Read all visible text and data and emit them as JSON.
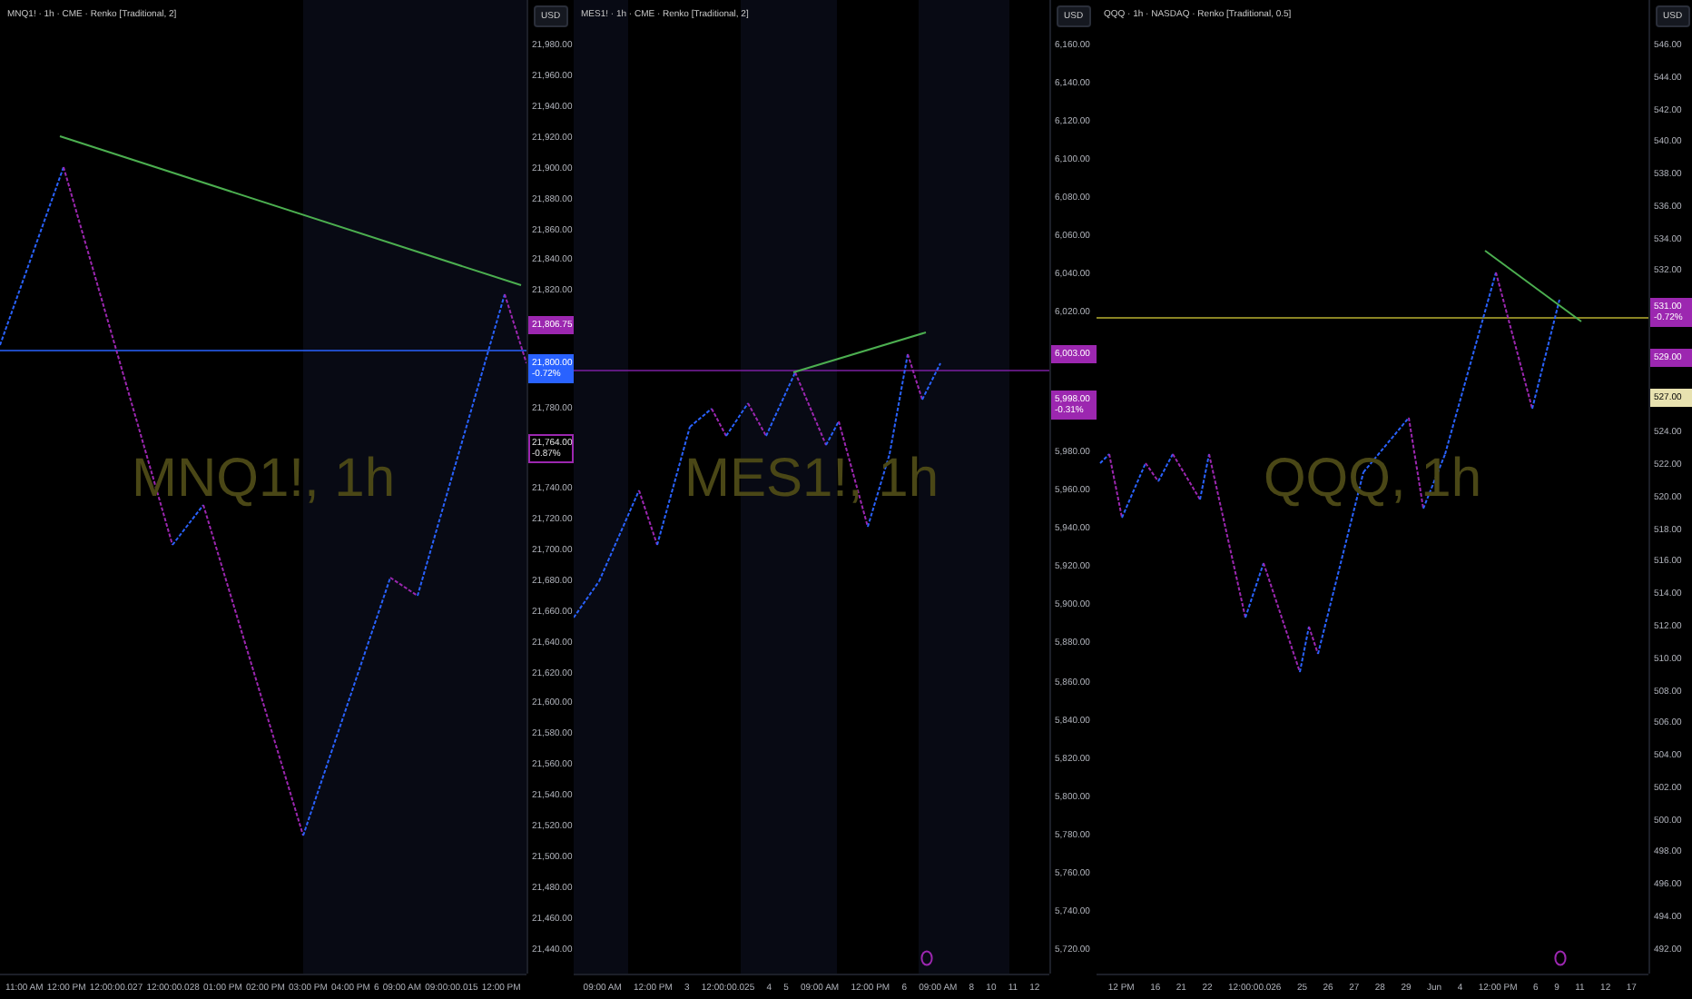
{
  "panels": [
    {
      "header": "MNQ1! · 1h · CME · Renko [Traditional, 2]",
      "watermark": "MNQ1!, 1h",
      "currency": "USD",
      "axis": [
        {
          "kind": "label",
          "lines": [
            "21,980.00"
          ]
        },
        {
          "kind": "label",
          "lines": [
            "21,960.00"
          ]
        },
        {
          "kind": "label",
          "lines": [
            "21,940.00"
          ]
        },
        {
          "kind": "label",
          "lines": [
            "21,920.00"
          ]
        },
        {
          "kind": "label",
          "lines": [
            "21,900.00"
          ]
        },
        {
          "kind": "label",
          "lines": [
            "21,880.00"
          ]
        },
        {
          "kind": "label",
          "lines": [
            "21,860.00"
          ]
        },
        {
          "kind": "label",
          "lines": [
            "21,840.00"
          ]
        },
        {
          "kind": "label",
          "lines": [
            "21,820.00"
          ]
        },
        {
          "kind": "tag",
          "lines": [
            "21,806.75"
          ],
          "color": "#9c27b0"
        },
        {
          "kind": "tag",
          "lines": [
            "21,800.00",
            "-0.72%"
          ],
          "color": "#2962ff"
        },
        {
          "kind": "label",
          "lines": [
            "21,780.00"
          ]
        },
        {
          "kind": "outline_tag",
          "lines": [
            "21,764.00",
            "-0.87%"
          ],
          "color": "#9c27b0"
        },
        {
          "kind": "label",
          "lines": [
            "21,740.00"
          ]
        },
        {
          "kind": "label",
          "lines": [
            "21,720.00"
          ]
        },
        {
          "kind": "label",
          "lines": [
            "21,700.00"
          ]
        },
        {
          "kind": "label",
          "lines": [
            "21,680.00"
          ]
        },
        {
          "kind": "label",
          "lines": [
            "21,660.00"
          ]
        },
        {
          "kind": "label",
          "lines": [
            "21,640.00"
          ]
        },
        {
          "kind": "label",
          "lines": [
            "21,620.00"
          ]
        },
        {
          "kind": "label",
          "lines": [
            "21,600.00"
          ]
        },
        {
          "kind": "label",
          "lines": [
            "21,580.00"
          ]
        },
        {
          "kind": "label",
          "lines": [
            "21,560.00"
          ]
        },
        {
          "kind": "label",
          "lines": [
            "21,540.00"
          ]
        },
        {
          "kind": "label",
          "lines": [
            "21,520.00"
          ]
        },
        {
          "kind": "label",
          "lines": [
            "21,500.00"
          ]
        },
        {
          "kind": "label",
          "lines": [
            "21,480.00"
          ]
        },
        {
          "kind": "label",
          "lines": [
            "21,460.00"
          ]
        },
        {
          "kind": "label",
          "lines": [
            "21,440.00"
          ]
        }
      ],
      "time_labels": [
        "11:00 AM",
        "12:00 PM",
        "12:00:00.027",
        "12:00:00.028",
        "01:00 PM",
        "02:00 PM",
        "03:00 PM",
        "04:00 PM",
        "6",
        "09:00 AM",
        "09:00:00.015",
        "12:00 PM"
      ]
    },
    {
      "header": "MES1! · 1h · CME · Renko [Traditional, 2]",
      "watermark": "MES1!, 1h",
      "currency": "USD",
      "axis": [
        {
          "kind": "label",
          "lines": [
            "6,160.00"
          ]
        },
        {
          "kind": "label",
          "lines": [
            "6,140.00"
          ]
        },
        {
          "kind": "label",
          "lines": [
            "6,120.00"
          ]
        },
        {
          "kind": "label",
          "lines": [
            "6,100.00"
          ]
        },
        {
          "kind": "label",
          "lines": [
            "6,080.00"
          ]
        },
        {
          "kind": "label",
          "lines": [
            "6,060.00"
          ]
        },
        {
          "kind": "label",
          "lines": [
            "6,040.00"
          ]
        },
        {
          "kind": "label",
          "lines": [
            "6,020.00"
          ]
        },
        {
          "kind": "tag",
          "lines": [
            "6,003.00"
          ],
          "color": "#9c27b0"
        },
        {
          "kind": "tag",
          "lines": [
            "5,998.00",
            "-0.31%"
          ],
          "color": "#9c27b0"
        },
        {
          "kind": "label",
          "lines": [
            "5,980.00"
          ]
        },
        {
          "kind": "label",
          "lines": [
            "5,960.00"
          ]
        },
        {
          "kind": "label",
          "lines": [
            "5,940.00"
          ]
        },
        {
          "kind": "label",
          "lines": [
            "5,920.00"
          ]
        },
        {
          "kind": "label",
          "lines": [
            "5,900.00"
          ]
        },
        {
          "kind": "label",
          "lines": [
            "5,880.00"
          ]
        },
        {
          "kind": "label",
          "lines": [
            "5,860.00"
          ]
        },
        {
          "kind": "label",
          "lines": [
            "5,840.00"
          ]
        },
        {
          "kind": "label",
          "lines": [
            "5,820.00"
          ]
        },
        {
          "kind": "label",
          "lines": [
            "5,800.00"
          ]
        },
        {
          "kind": "label",
          "lines": [
            "5,780.00"
          ]
        },
        {
          "kind": "label",
          "lines": [
            "5,760.00"
          ]
        },
        {
          "kind": "label",
          "lines": [
            "5,740.00"
          ]
        },
        {
          "kind": "label",
          "lines": [
            "5,720.00"
          ]
        }
      ],
      "time_labels": [
        "09:00 AM",
        "12:00 PM",
        "3",
        "12:00:00.025",
        "4",
        "5",
        "09:00 AM",
        "12:00 PM",
        "6",
        "09:00 AM",
        "8",
        "10",
        "11",
        "12"
      ],
      "has_event": true
    },
    {
      "header": "QQQ · 1h · NASDAQ · Renko [Traditional, 0.5]",
      "watermark": "QQQ, 1h",
      "currency": "USD",
      "axis": [
        {
          "kind": "label",
          "lines": [
            "546.00"
          ]
        },
        {
          "kind": "label",
          "lines": [
            "544.00"
          ]
        },
        {
          "kind": "label",
          "lines": [
            "542.00"
          ]
        },
        {
          "kind": "label",
          "lines": [
            "540.00"
          ]
        },
        {
          "kind": "label",
          "lines": [
            "538.00"
          ]
        },
        {
          "kind": "label",
          "lines": [
            "536.00"
          ]
        },
        {
          "kind": "label",
          "lines": [
            "534.00"
          ]
        },
        {
          "kind": "label",
          "lines": [
            "532.00"
          ]
        },
        {
          "kind": "tag",
          "lines": [
            "531.00",
            "-0.72%"
          ],
          "color": "#9c27b0"
        },
        {
          "kind": "tag",
          "lines": [
            "529.00"
          ],
          "color": "#9c27b0"
        },
        {
          "kind": "tag",
          "lines": [
            "527.00"
          ],
          "color": "#e8e2b0"
        },
        {
          "kind": "label",
          "lines": [
            "524.00"
          ]
        },
        {
          "kind": "label",
          "lines": [
            "522.00"
          ]
        },
        {
          "kind": "label",
          "lines": [
            "520.00"
          ]
        },
        {
          "kind": "label",
          "lines": [
            "518.00"
          ]
        },
        {
          "kind": "label",
          "lines": [
            "516.00"
          ]
        },
        {
          "kind": "label",
          "lines": [
            "514.00"
          ]
        },
        {
          "kind": "label",
          "lines": [
            "512.00"
          ]
        },
        {
          "kind": "label",
          "lines": [
            "510.00"
          ]
        },
        {
          "kind": "label",
          "lines": [
            "508.00"
          ]
        },
        {
          "kind": "label",
          "lines": [
            "506.00"
          ]
        },
        {
          "kind": "label",
          "lines": [
            "504.00"
          ]
        },
        {
          "kind": "label",
          "lines": [
            "502.00"
          ]
        },
        {
          "kind": "label",
          "lines": [
            "500.00"
          ]
        },
        {
          "kind": "label",
          "lines": [
            "498.00"
          ]
        },
        {
          "kind": "label",
          "lines": [
            "496.00"
          ]
        },
        {
          "kind": "label",
          "lines": [
            "494.00"
          ]
        },
        {
          "kind": "label",
          "lines": [
            "492.00"
          ]
        }
      ],
      "time_labels": [
        "12 PM",
        "16",
        "21",
        "22",
        "12:00:00.026",
        "25",
        "26",
        "27",
        "28",
        "29",
        "Jun",
        "4",
        "12:00 PM",
        "6",
        "9",
        "11",
        "12",
        "17"
      ],
      "has_event": true
    }
  ]
}
